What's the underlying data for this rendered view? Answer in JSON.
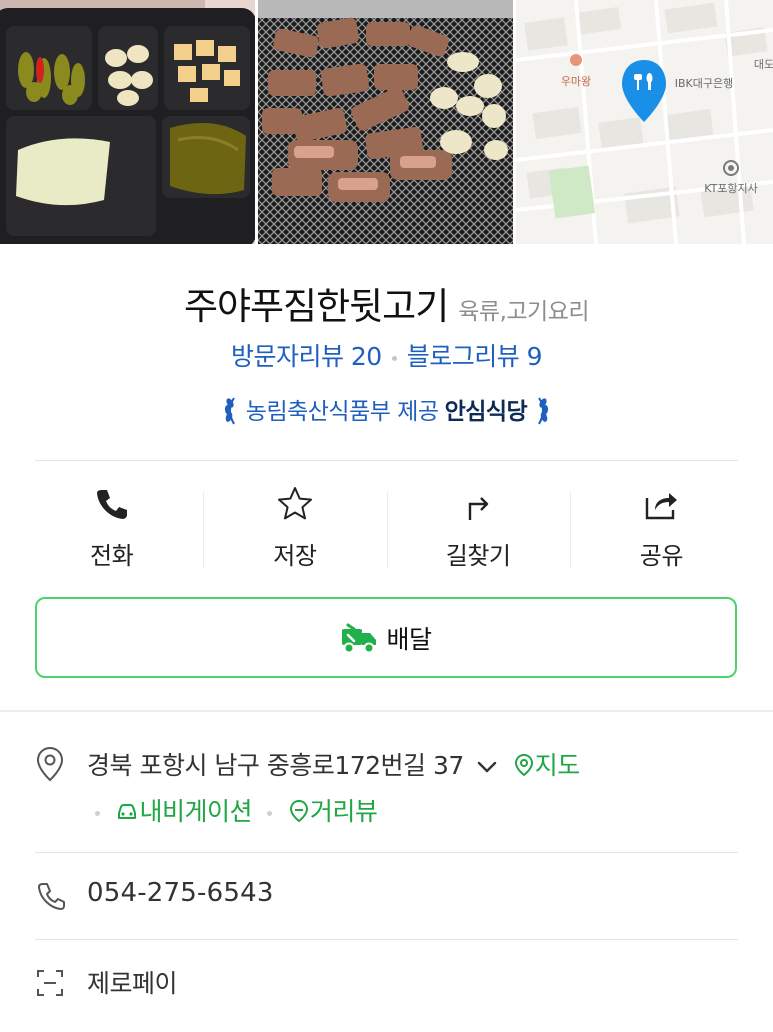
{
  "map_labels": {
    "poi1": "우마왕",
    "bank": "IBK대구은행",
    "edge": "대도",
    "kt": "KT포항지사"
  },
  "place": {
    "name": "주야푸짐한뒷고기",
    "category": "육류,고기요리",
    "visitor_reviews": "방문자리뷰 20",
    "blog_reviews": "블로그리뷰 9",
    "cert_provider": "농림축산식품부 제공",
    "cert_badge": "안심식당"
  },
  "actions": {
    "call": "전화",
    "save": "저장",
    "directions": "길찾기",
    "share": "공유"
  },
  "delivery": {
    "label": "배달"
  },
  "address": {
    "text": "경북 포항시 남구 중흥로172번길 37",
    "map_link": "지도",
    "navigation": "내비게이션",
    "street_view": "거리뷰"
  },
  "phone": "054-275-6543",
  "payment": "제로페이",
  "colors": {
    "link_blue": "#1e5fbf",
    "green": "#21a645",
    "delivery_border": "#4cd26b",
    "map_pin": "#1a8fe8"
  },
  "icons": {
    "call": "phone-icon",
    "save": "star-icon",
    "directions": "route-icon",
    "share": "share-icon",
    "delivery": "delivery-truck-icon",
    "address": "location-pin-icon",
    "phone": "phone-outline-icon",
    "payment": "scan-icon"
  }
}
